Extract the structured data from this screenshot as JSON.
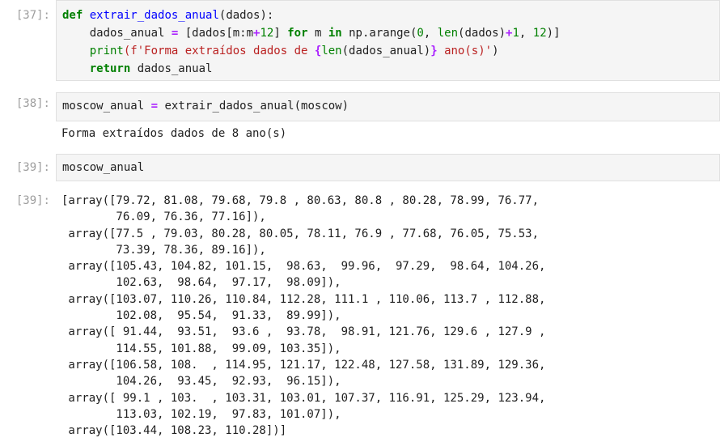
{
  "cells": [
    {
      "prompt": "[37]:",
      "code": {
        "l1": {
          "def": "def",
          "name": "extrair_dados_anual",
          "args": "(dados):"
        },
        "l2": {
          "indent": "    ",
          "var": "dados_anual",
          "eq": "=",
          "open": "[dados[m:m",
          "plus": "+",
          "twelve": "12",
          "close": "]",
          "for": "for",
          "m": "m",
          "in": "in",
          "np": "np.arange(",
          "zero": "0",
          "comma": ",",
          "len": "len",
          "dados": "(dados)",
          "plus2": "+",
          "one": "1",
          "comma2": ",",
          "twelve2": "12",
          "end": ")]"
        },
        "l3": {
          "indent": "    ",
          "print": "print",
          "fstr1": "(f'Forma extraídos dados de ",
          "brace_open": "{",
          "len": "len",
          "inner": "(dados_anual)",
          "brace_close": "}",
          "fstr2": " ano(s)'",
          "end": ")"
        },
        "l4": {
          "indent": "    ",
          "return": "return",
          "val": " dados_anual"
        }
      }
    },
    {
      "prompt": "[38]:",
      "code_line": {
        "var": "moscow_anual",
        "eq": "=",
        "call": "extrair_dados_anual(moscow)"
      },
      "output": "Forma extraídos dados de 8 ano(s)"
    },
    {
      "prompt": "[39]:",
      "code_line": "moscow_anual"
    },
    {
      "prompt": "[39]:",
      "output_lines": [
        "[array([79.72, 81.08, 79.68, 79.8 , 80.63, 80.8 , 80.28, 78.99, 76.77,",
        "        76.09, 76.36, 77.16]),",
        " array([77.5 , 79.03, 80.28, 80.05, 78.11, 76.9 , 77.68, 76.05, 75.53,",
        "        73.39, 78.36, 89.16]),",
        " array([105.43, 104.82, 101.15,  98.63,  99.96,  97.29,  98.64, 104.26,",
        "        102.63,  98.64,  97.17,  98.09]),",
        " array([103.07, 110.26, 110.84, 112.28, 111.1 , 110.06, 113.7 , 112.88,",
        "        102.08,  95.54,  91.33,  89.99]),",
        " array([ 91.44,  93.51,  93.6 ,  93.78,  98.91, 121.76, 129.6 , 127.9 ,",
        "        114.55, 101.88,  99.09, 103.35]),",
        " array([106.58, 108.  , 114.95, 121.17, 122.48, 127.58, 131.89, 129.36,",
        "        104.26,  93.45,  92.93,  96.15]),",
        " array([ 99.1 , 103.  , 103.31, 103.01, 107.37, 116.91, 125.29, 123.94,",
        "        113.03, 102.19,  97.83, 101.07]),",
        " array([103.44, 108.23, 110.28])]"
      ]
    }
  ]
}
